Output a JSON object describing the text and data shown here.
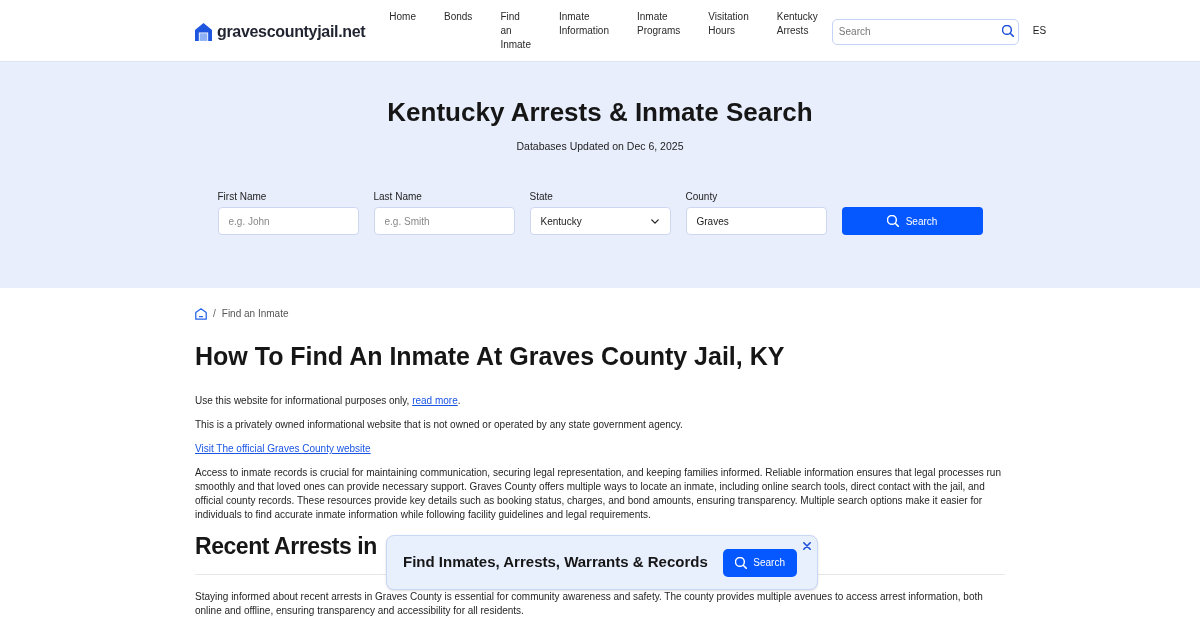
{
  "header": {
    "logo": "gravescountyjail.net",
    "nav": [
      {
        "label": "Home"
      },
      {
        "label": "Bonds"
      },
      {
        "label": "Find an Inmate"
      },
      {
        "label": "Inmate Information"
      },
      {
        "label": "Inmate Programs"
      },
      {
        "label": "Visitation Hours"
      },
      {
        "label": "Kentucky Arrests"
      }
    ],
    "search": {
      "placeholder": "Search"
    },
    "language": "ES"
  },
  "hero": {
    "title": "Kentucky Arrests & Inmate Search",
    "subtitle": "Databases Updated on Dec 6, 2025",
    "fields": [
      {
        "label": "First Name",
        "kind": "text",
        "placeholder": "e.g. John"
      },
      {
        "label": "Last Name",
        "kind": "text",
        "placeholder": "e.g. Smith"
      },
      {
        "label": "State",
        "kind": "select",
        "value": "Kentucky"
      },
      {
        "label": "County",
        "kind": "text",
        "value": "Graves"
      }
    ],
    "button": "Search"
  },
  "content": {
    "breadcrumb": {
      "separator": "/",
      "current": "Find an Inmate"
    },
    "title": "How To Find An Inmate At Graves County Jail, KY",
    "intro": [
      {
        "parts": [
          {
            "kind": "text",
            "text": "Use this website for informational purposes only, "
          },
          {
            "kind": "link",
            "text": "read more"
          },
          {
            "kind": "text",
            "text": "."
          }
        ]
      },
      {
        "parts": [
          {
            "kind": "text",
            "text": "This is a privately owned informational website that is not owned or operated by any state government agency."
          }
        ]
      },
      {
        "parts": [
          {
            "kind": "link",
            "text": "Visit The official Graves County website"
          }
        ]
      },
      {
        "parts": [
          {
            "kind": "text",
            "text": "Access to inmate records is crucial for maintaining communication, securing legal representation, and keeping families informed. Reliable information ensures that legal processes run smoothly and that loved ones can provide necessary support. Graves County offers multiple ways to locate an inmate, including online search tools, direct contact with the jail, and official county records. These resources provide key details such as booking status, charges, and bond amounts, ensuring transparency. Multiple search options make it easier for individuals to find accurate inmate information while following facility guidelines and legal requirements."
          }
        ]
      }
    ],
    "sections": [
      {
        "heading": "Recent Arrests in",
        "paragraphs": [
          {
            "parts": [
              {
                "kind": "text",
                "text": "Staying informed about recent arrests in Graves County is essential for community awareness and safety. The county provides multiple avenues to access arrest information, both online and offline, ensuring transparency and accessibility for all residents."
              }
            ]
          }
        ]
      }
    ]
  },
  "popup": {
    "text": "Find Inmates, Arrests, Warrants & Records",
    "button": "Search"
  }
}
